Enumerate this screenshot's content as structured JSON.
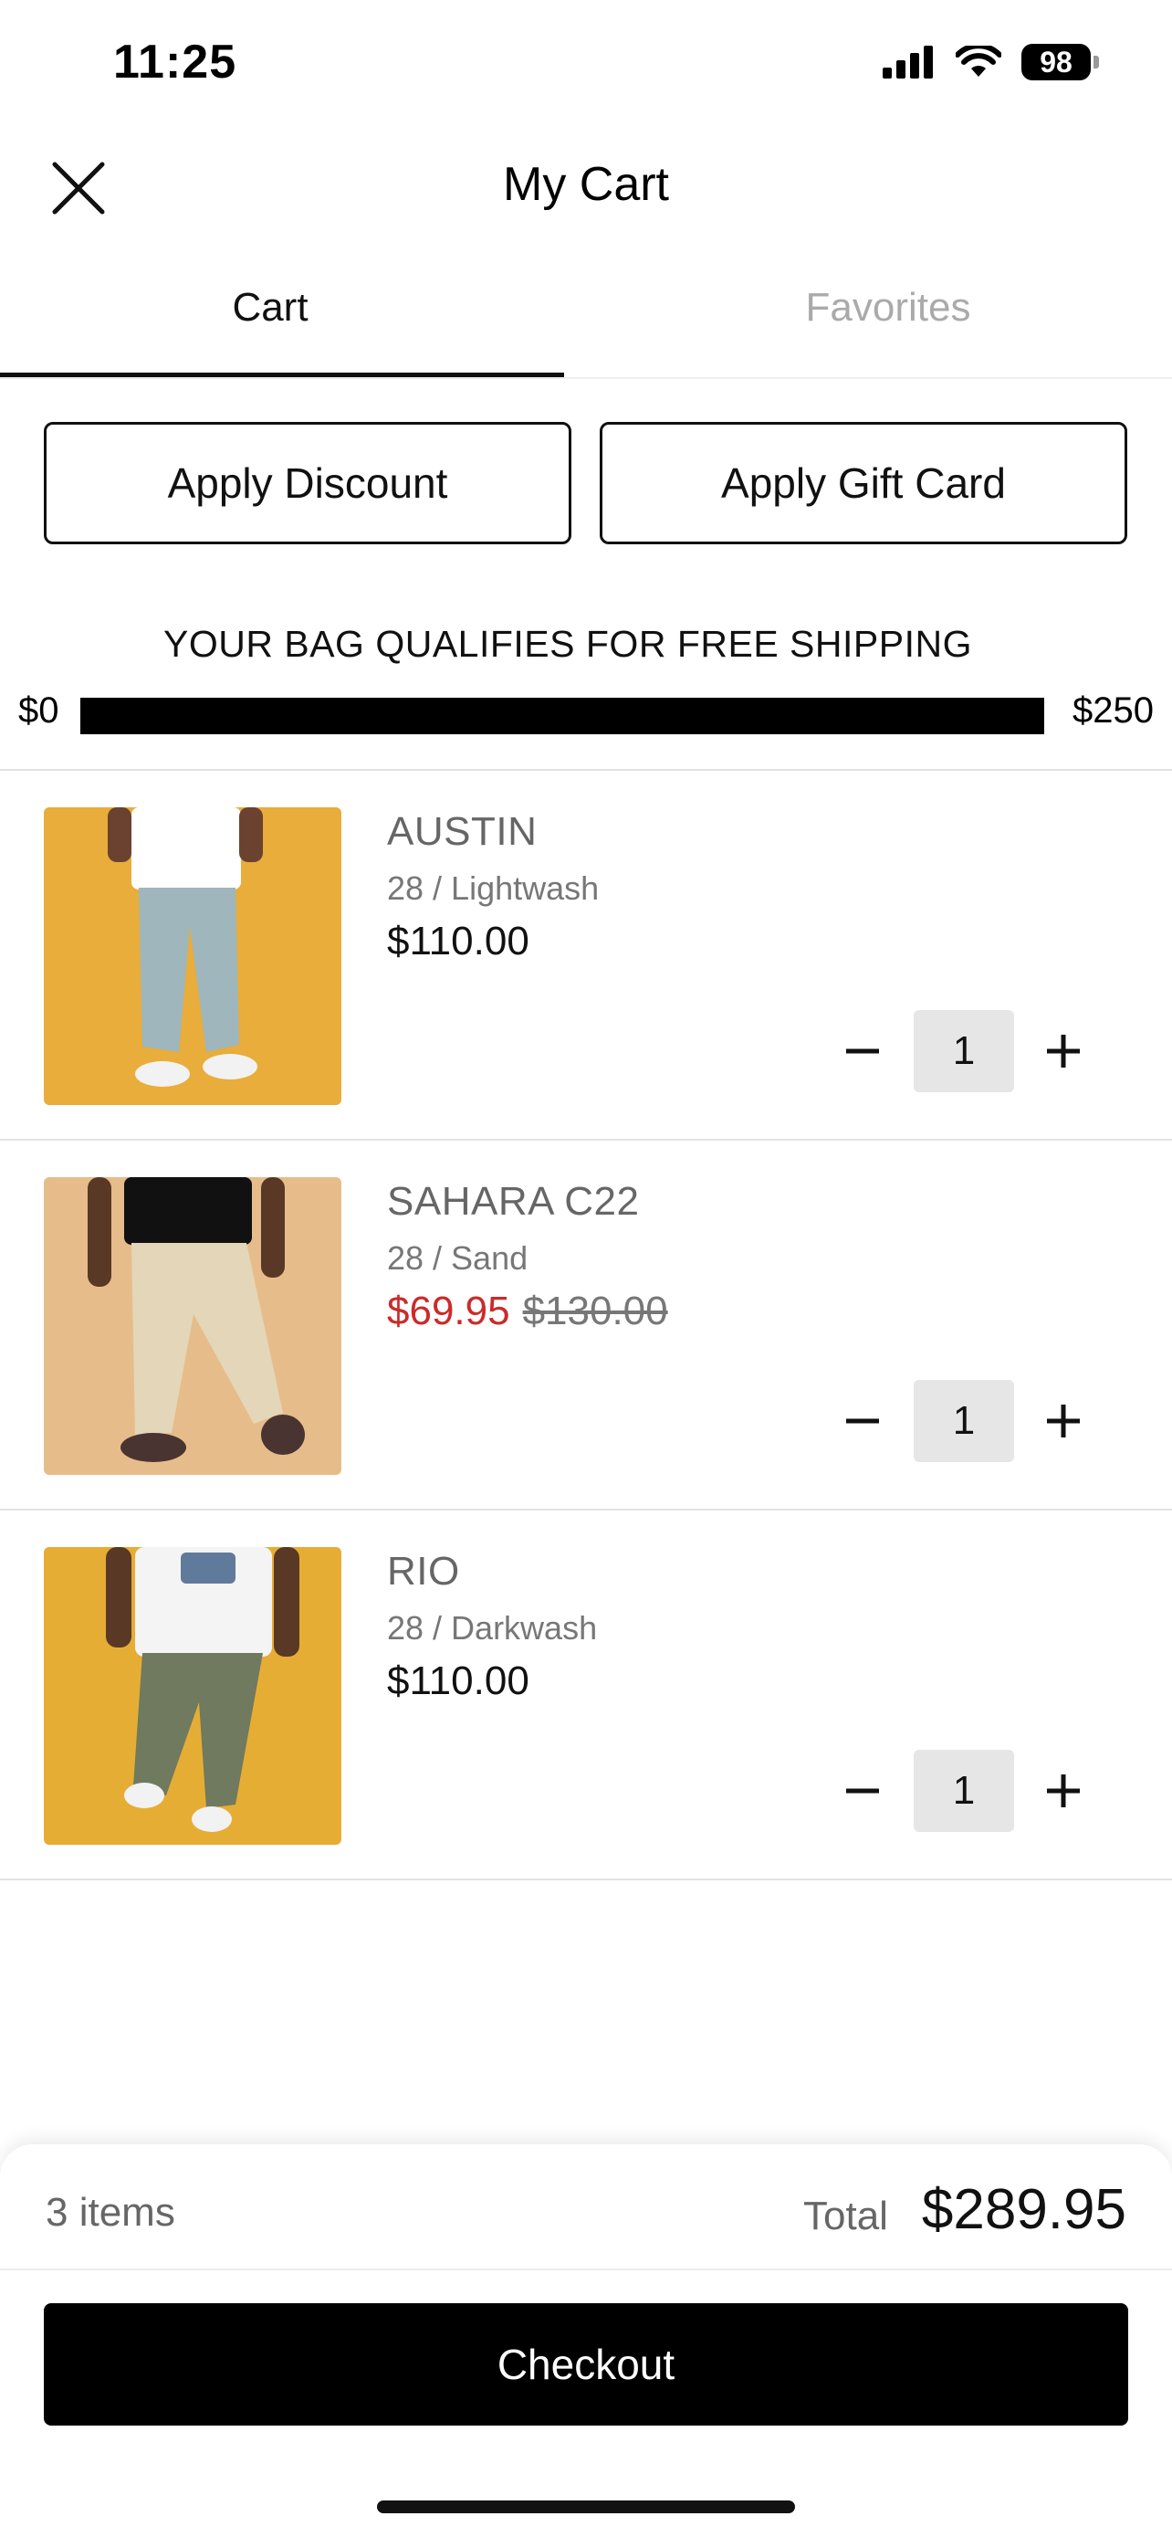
{
  "status_bar": {
    "time": "11:25",
    "battery": "98",
    "icons": [
      "signal-icon",
      "wifi-icon",
      "battery-icon"
    ]
  },
  "header": {
    "title": "My Cart",
    "close_icon": "close-icon"
  },
  "tabs": [
    {
      "label": "Cart",
      "active": true
    },
    {
      "label": "Favorites",
      "active": false
    }
  ],
  "actions": {
    "discount_label": "Apply Discount",
    "gift_card_label": "Apply Gift Card"
  },
  "shipping": {
    "message": "YOUR BAG QUALIFIES FOR FREE SHIPPING",
    "min_label": "$0",
    "max_label": "$250",
    "progress": 1.0
  },
  "items": [
    {
      "name": "AUSTIN",
      "variant": "28 / Lightwash",
      "price": "$110.00",
      "quantity": "1",
      "image_colors": {
        "bg": "#e8ad3a",
        "pants": "#9fb6bd",
        "shirt": "#ffffff"
      }
    },
    {
      "name": "SAHARA C22",
      "variant": "28 / Sand",
      "sale_price": "$69.95",
      "original_price": "$130.00",
      "quantity": "1",
      "image_colors": {
        "bg": "#e6bd8a",
        "pants": "#e4d6b8",
        "shirt": "#111111"
      }
    },
    {
      "name": "RIO",
      "variant": "28 / Darkwash",
      "price": "$110.00",
      "quantity": "1",
      "image_colors": {
        "bg": "#e6ad35",
        "pants": "#6f7a5e",
        "shirt": "#f4f4f4"
      }
    }
  ],
  "summary": {
    "items_count": "3 items",
    "total_label": "Total",
    "total_value": "$289.95"
  },
  "checkout": {
    "label": "Checkout"
  },
  "colors": {
    "sale": "#cc2a2a",
    "primary": "#000000"
  }
}
